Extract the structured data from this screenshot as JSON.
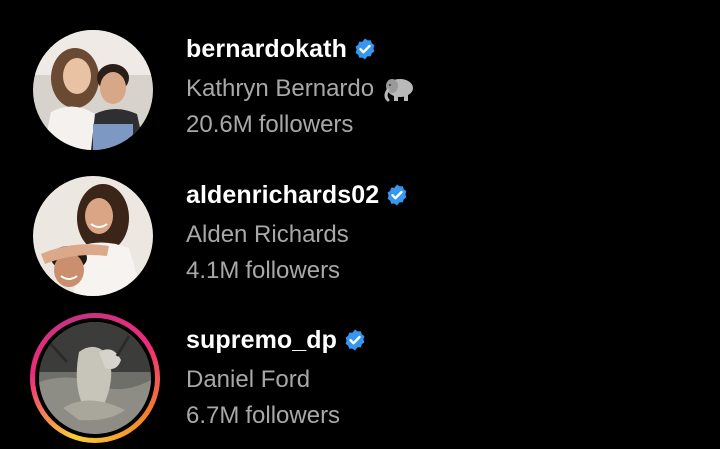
{
  "colors": {
    "background": "#000000",
    "username": "#ffffff",
    "secondary_text": "#a8a8a8",
    "verified_badge": "#3797f0"
  },
  "accounts": [
    {
      "username": "bernardokath",
      "verified": true,
      "full_name": "Kathryn Bernardo",
      "name_emoji": "elephant-icon",
      "followers_count": "20.6M",
      "followers_label": "followers",
      "has_story_ring": false
    },
    {
      "username": "aldenrichards02",
      "verified": true,
      "full_name": "Alden Richards",
      "followers_count": "4.1M",
      "followers_label": "followers",
      "has_story_ring": false
    },
    {
      "username": "supremo_dp",
      "verified": true,
      "full_name": "Daniel Ford",
      "followers_count": "6.7M",
      "followers_label": "followers",
      "has_story_ring": true
    }
  ]
}
